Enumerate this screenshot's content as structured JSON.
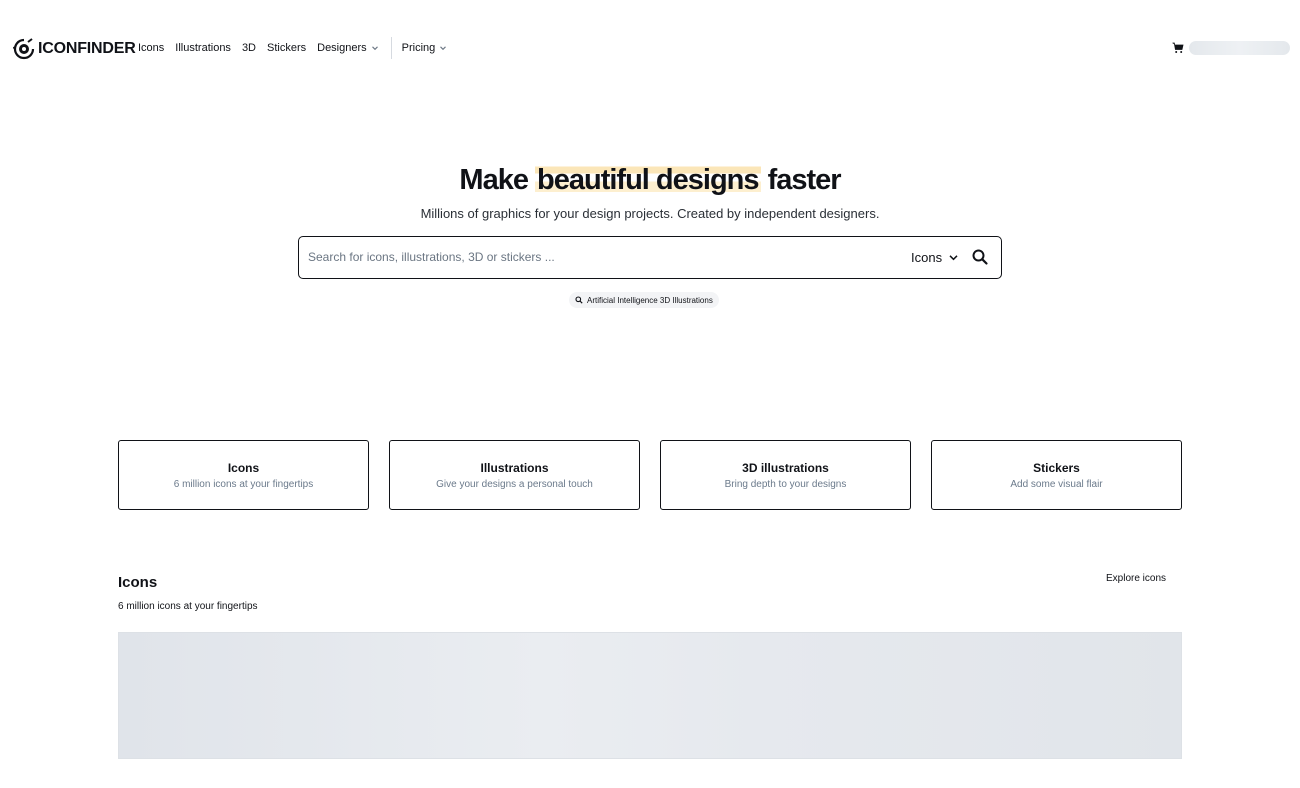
{
  "header": {
    "logo_text": "ICONFINDER",
    "nav": {
      "icons": "Icons",
      "illustrations": "Illustrations",
      "three_d": "3D",
      "stickers": "Stickers",
      "designers": "Designers",
      "pricing": "Pricing"
    },
    "cart_icon": "cart-icon"
  },
  "hero": {
    "title_prefix": "Make",
    "title_highlight": "beautiful designs",
    "title_suffix": "faster",
    "subtitle": "Millions of graphics for your design projects. Created by independent designers.",
    "search": {
      "placeholder": "Search for icons, illustrations, 3D or stickers ...",
      "value": "",
      "type_selected": "Icons"
    },
    "suggestion": "Artificial Intelligence 3D Illustrations"
  },
  "categories": [
    {
      "title": "Icons",
      "description": "6 million icons at your fingertips"
    },
    {
      "title": "Illustrations",
      "description": "Give your designs a personal touch"
    },
    {
      "title": "3D illustrations",
      "description": "Bring depth to your designs"
    },
    {
      "title": "Stickers",
      "description": "Add some visual flair"
    }
  ],
  "icons_section": {
    "title": "Icons",
    "subtitle": "6 million icons at your fingertips",
    "explore_label": "Explore icons"
  },
  "colors": {
    "text": "#101217",
    "muted": "#6b7a8b",
    "highlight": "#fbe6b8",
    "skeleton": "#e4e8ec"
  }
}
